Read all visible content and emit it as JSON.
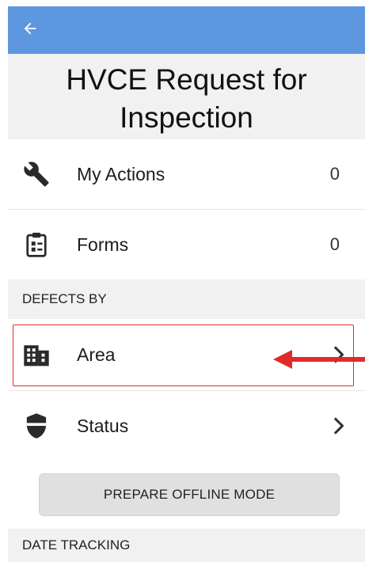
{
  "header": {
    "back_icon": "arrow-left-icon",
    "title": "HVCE Request for Inspection",
    "bar_color": "#5c97df"
  },
  "menu": {
    "my_actions": {
      "label": "My Actions",
      "count": "0",
      "icon": "wrench-icon"
    },
    "forms": {
      "label": "Forms",
      "count": "0",
      "icon": "clipboard-icon"
    }
  },
  "defects_by": {
    "header": "DEFECTS BY",
    "area": {
      "label": "Area",
      "icon": "building-icon",
      "chevron": "chevron-right-icon"
    },
    "status": {
      "label": "Status",
      "icon": "shield-icon",
      "chevron": "chevron-right-icon"
    }
  },
  "offline": {
    "button_label": "PREPARE OFFLINE MODE"
  },
  "date_tracking": {
    "header": "DATE TRACKING"
  },
  "annotation": {
    "color": "#e02b2b"
  }
}
